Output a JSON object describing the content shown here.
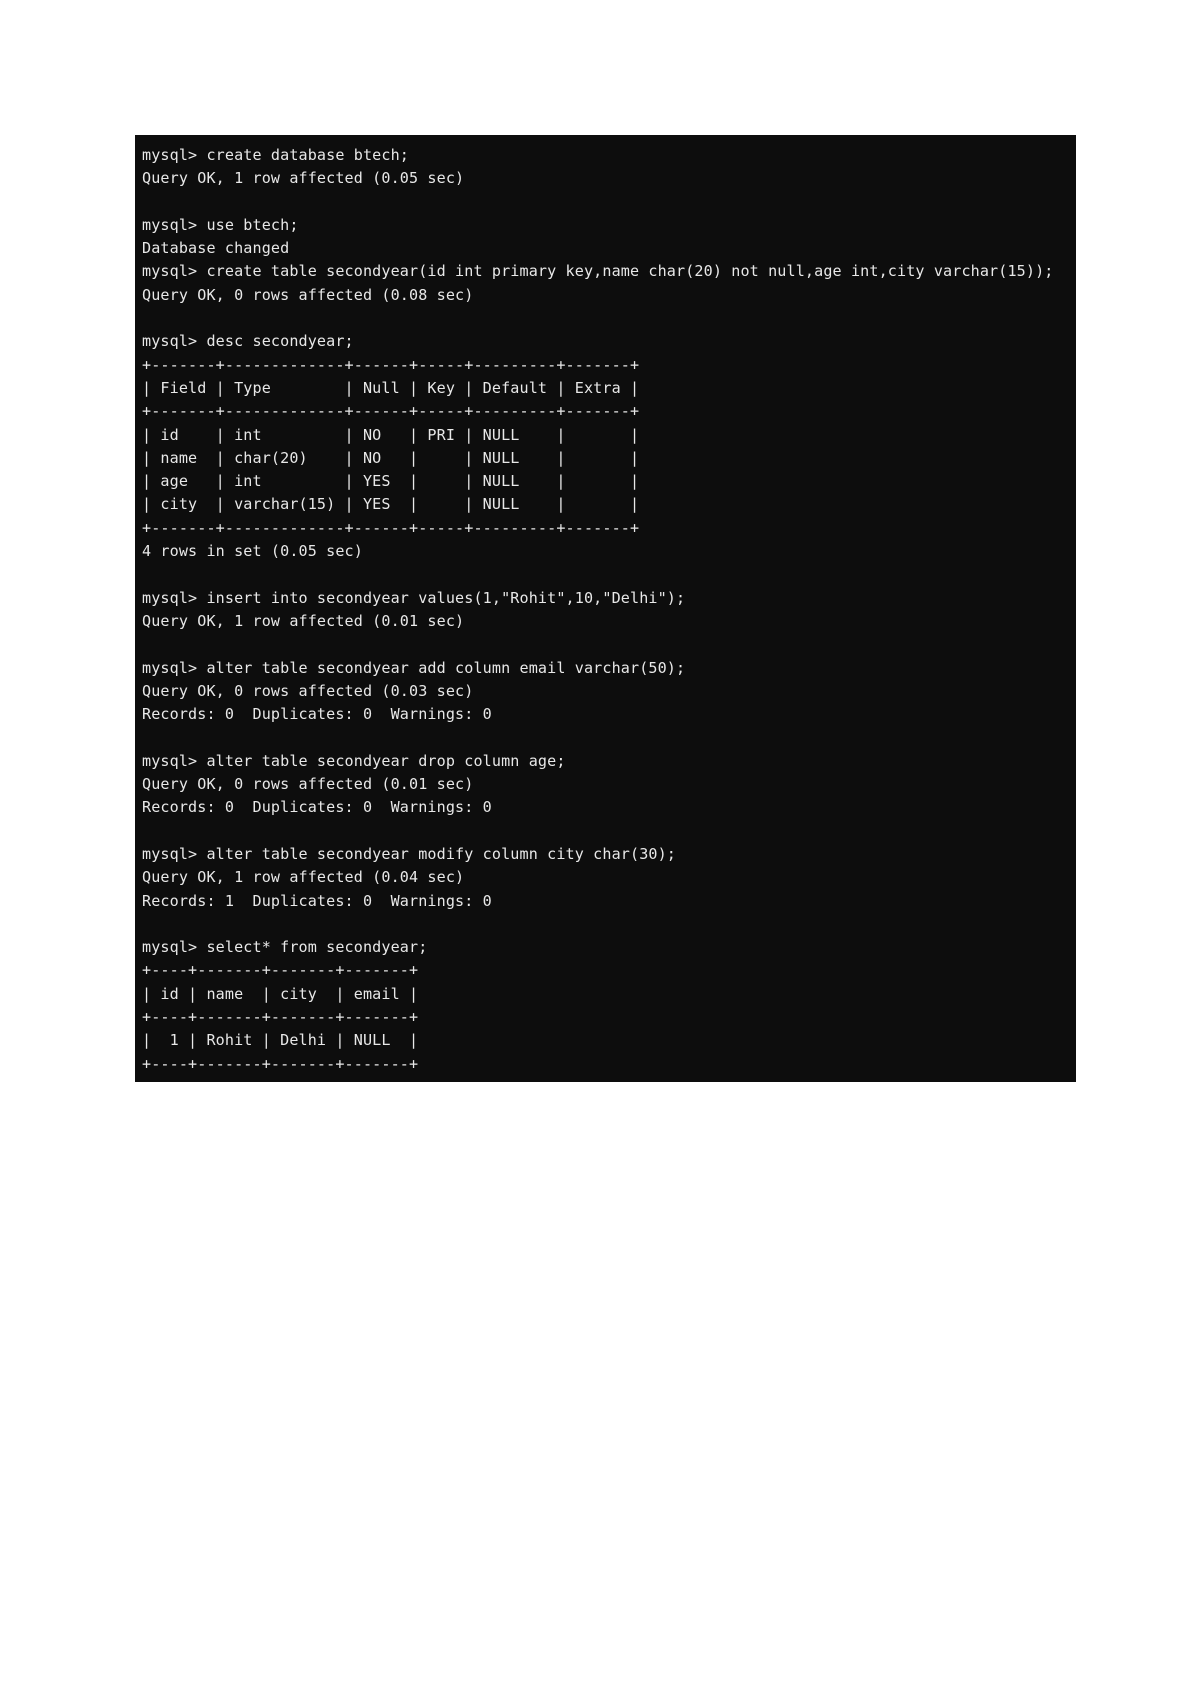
{
  "page": {
    "background_color": "#ffffff"
  },
  "terminal": {
    "background_color": "#0d0d0d",
    "text_color": "#e8e8e8",
    "prompt": "mysql>",
    "session_lines": [
      "mysql> create database btech;",
      "Query OK, 1 row affected (0.05 sec)",
      "",
      "mysql> use btech;",
      "Database changed",
      "mysql> create table secondyear(id int primary key,name char(20) not null,age int,city varchar(15));",
      "Query OK, 0 rows affected (0.08 sec)",
      "",
      "mysql> desc secondyear;",
      "+-------+-------------+------+-----+---------+-------+",
      "| Field | Type        | Null | Key | Default | Extra |",
      "+-------+-------------+------+-----+---------+-------+",
      "| id    | int         | NO   | PRI | NULL    |       |",
      "| name  | char(20)    | NO   |     | NULL    |       |",
      "| age   | int         | YES  |     | NULL    |       |",
      "| city  | varchar(15) | YES  |     | NULL    |       |",
      "+-------+-------------+------+-----+---------+-------+",
      "4 rows in set (0.05 sec)",
      "",
      "mysql> insert into secondyear values(1,\"Rohit\",10,\"Delhi\");",
      "Query OK, 1 row affected (0.01 sec)",
      "",
      "mysql> alter table secondyear add column email varchar(50);",
      "Query OK, 0 rows affected (0.03 sec)",
      "Records: 0  Duplicates: 0  Warnings: 0",
      "",
      "mysql> alter table secondyear drop column age;",
      "Query OK, 0 rows affected (0.01 sec)",
      "Records: 0  Duplicates: 0  Warnings: 0",
      "",
      "mysql> alter table secondyear modify column city char(30);",
      "Query OK, 1 row affected (0.04 sec)",
      "Records: 1  Duplicates: 0  Warnings: 0",
      "",
      "mysql> select* from secondyear;",
      "+----+-------+-------+-------+",
      "| id | name  | city  | email |",
      "+----+-------+-------+-------+",
      "|  1 | Rohit | Delhi | NULL  |",
      "+----+-------+-------+-------+"
    ],
    "commands": [
      "create database btech;",
      "use btech;",
      "create table secondyear(id int primary key,name char(20) not null,age int,city varchar(15));",
      "desc secondyear;",
      "insert into secondyear values(1,\"Rohit\",10,\"Delhi\");",
      "alter table secondyear add column email varchar(50);",
      "alter table secondyear drop column age;",
      "alter table secondyear modify column city char(30);",
      "select* from secondyear;"
    ],
    "status_messages": [
      "Query OK, 1 row affected (0.05 sec)",
      "Database changed",
      "Query OK, 0 rows affected (0.08 sec)",
      "4 rows in set (0.05 sec)",
      "Query OK, 1 row affected (0.01 sec)",
      "Query OK, 0 rows affected (0.03 sec)",
      "Records: 0  Duplicates: 0  Warnings: 0",
      "Query OK, 0 rows affected (0.01 sec)",
      "Records: 0  Duplicates: 0  Warnings: 0",
      "Query OK, 1 row affected (0.04 sec)",
      "Records: 1  Duplicates: 0  Warnings: 0"
    ],
    "describe_table": {
      "headers": [
        "Field",
        "Type",
        "Null",
        "Key",
        "Default",
        "Extra"
      ],
      "rows": [
        [
          "id",
          "int",
          "NO",
          "PRI",
          "NULL",
          ""
        ],
        [
          "name",
          "char(20)",
          "NO",
          "",
          "NULL",
          ""
        ],
        [
          "age",
          "int",
          "YES",
          "",
          "NULL",
          ""
        ],
        [
          "city",
          "varchar(15)",
          "YES",
          "",
          "NULL",
          ""
        ]
      ],
      "row_count_label": "4 rows in set (0.05 sec)"
    },
    "select_table": {
      "headers": [
        "id",
        "name",
        "city",
        "email"
      ],
      "rows": [
        [
          "1",
          "Rohit",
          "Delhi",
          "NULL"
        ]
      ]
    }
  }
}
